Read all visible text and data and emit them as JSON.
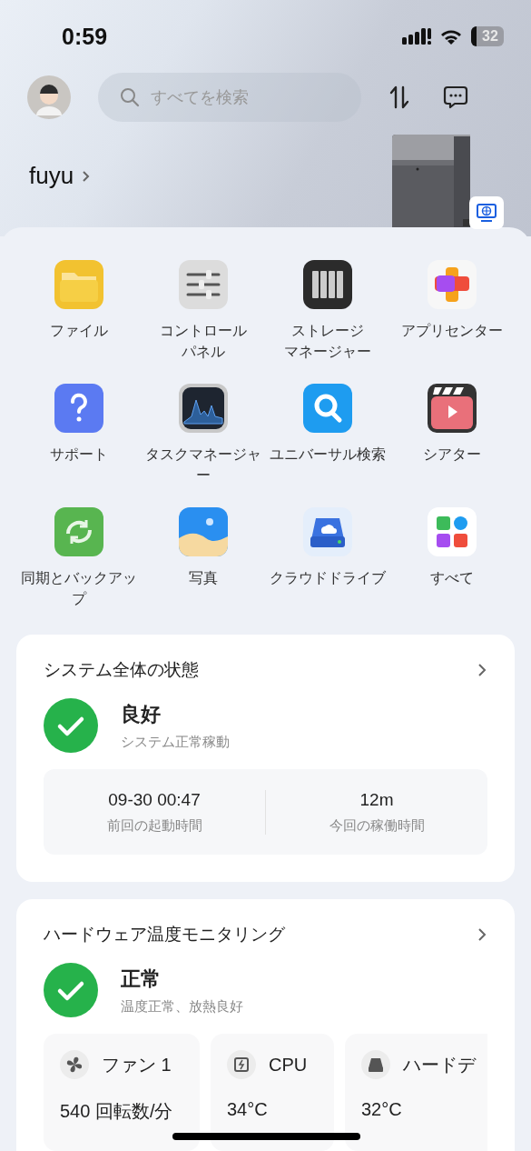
{
  "status_bar": {
    "time": "0:59",
    "battery": "32"
  },
  "header": {
    "search": {
      "placeholder": "すべてを検索"
    },
    "user": {
      "name": "fuyu"
    }
  },
  "apps": [
    {
      "kind": "folder",
      "lines": [
        "ファイル"
      ]
    },
    {
      "kind": "sliders",
      "lines": [
        "コントロール",
        "パネル"
      ]
    },
    {
      "kind": "storage",
      "lines": [
        "ストレージ",
        "マネージャー"
      ]
    },
    {
      "kind": "appcenter",
      "lines": [
        "アプリセンター"
      ]
    },
    {
      "kind": "help",
      "lines": [
        "サポート"
      ]
    },
    {
      "kind": "monitor",
      "lines": [
        "タスクマネージャ",
        "ー"
      ]
    },
    {
      "kind": "search",
      "lines": [
        "ユニバーサル検索"
      ]
    },
    {
      "kind": "theater",
      "lines": [
        "シアター"
      ]
    },
    {
      "kind": "sync",
      "lines": [
        "同期とバックアッ",
        "プ"
      ]
    },
    {
      "kind": "photos",
      "lines": [
        "写真"
      ]
    },
    {
      "kind": "cloud",
      "lines": [
        "クラウドドライブ"
      ]
    },
    {
      "kind": "all",
      "lines": [
        "すべて"
      ]
    }
  ],
  "system_status": {
    "title": "システム全体の状態",
    "status": "良好",
    "detail": "システム正常稼動",
    "stats": [
      {
        "value": "09-30 00:47",
        "label": "前回の起動時間"
      },
      {
        "value": "12m",
        "label": "今回の稼働時間"
      }
    ]
  },
  "hardware_temp": {
    "title": "ハードウェア温度モニタリング",
    "status": "正常",
    "detail": "温度正常、放熱良好",
    "sensors": [
      {
        "kind": "fan",
        "name": "ファン 1",
        "value": "540 回転数/分"
      },
      {
        "kind": "cpu",
        "name": "CPU",
        "value": "34°C"
      },
      {
        "kind": "disk",
        "name": "ハードデ",
        "value": "32°C"
      }
    ]
  }
}
